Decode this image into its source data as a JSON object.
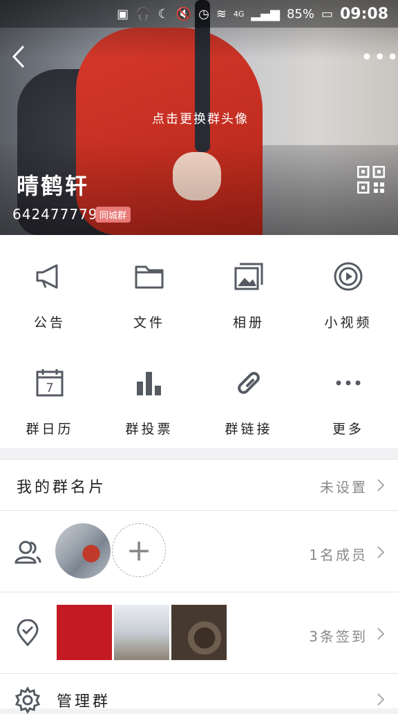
{
  "status_bar": {
    "battery": "85%",
    "time": "09:08",
    "network": "4G"
  },
  "header": {
    "change_avatar_text": "点击更换群头像",
    "group_name": "晴鹤轩",
    "group_number": "642477779",
    "group_tag": "同城群"
  },
  "grid": {
    "items": [
      {
        "label": "公告",
        "icon": "megaphone-icon"
      },
      {
        "label": "文件",
        "icon": "folder-icon"
      },
      {
        "label": "相册",
        "icon": "album-icon"
      },
      {
        "label": "小视频",
        "icon": "video-icon"
      },
      {
        "label": "群日历",
        "icon": "calendar-icon"
      },
      {
        "label": "群投票",
        "icon": "vote-chart-icon"
      },
      {
        "label": "群链接",
        "icon": "link-icon"
      },
      {
        "label": "更多",
        "icon": "more-dots-icon"
      }
    ]
  },
  "calendar_day": "7",
  "rows": {
    "card": {
      "label": "我的群名片",
      "value": "未设置"
    },
    "members": {
      "value": "1名成员"
    },
    "checkin": {
      "value": "3条签到"
    },
    "manage": {
      "label": "管理群"
    }
  },
  "colors": {
    "accent_tag": "#e87b78",
    "icon_stroke": "#555a63"
  }
}
